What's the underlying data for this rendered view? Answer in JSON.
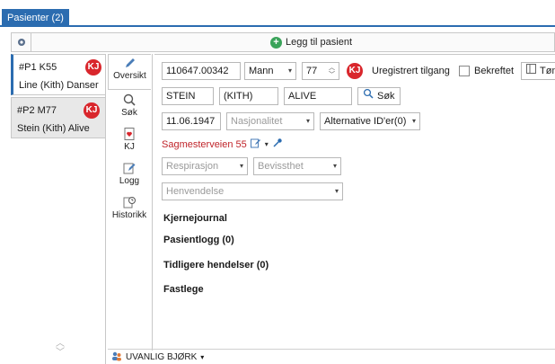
{
  "tab": {
    "label": "Pasienter (2)"
  },
  "toolbar": {
    "add_patient": "Legg til pasient",
    "settings_icon": "gear-icon"
  },
  "patients": [
    {
      "id": "#P1 K55",
      "name": "Line (Kith) Danser",
      "badge": "KJ"
    },
    {
      "id": "#P2 M77",
      "name": "Stein (Kith) Alive",
      "badge": "KJ"
    }
  ],
  "nav": [
    {
      "label": "Oversikt",
      "icon": "pencil-icon"
    },
    {
      "label": "Søk",
      "icon": "search-icon"
    },
    {
      "label": "KJ",
      "icon": "heart-document-icon"
    },
    {
      "label": "Logg",
      "icon": "edit-log-icon"
    },
    {
      "label": "Historikk",
      "icon": "history-icon"
    }
  ],
  "form": {
    "ssn": "110647.00342",
    "gender": "Mann",
    "age": "77",
    "badge": "KJ",
    "access": "Uregistrert tilgang",
    "confirmed": "Bekreftet",
    "clear": "Tøm",
    "first_name": "STEIN",
    "middle_name": "(KITH)",
    "last_name": "ALIVE",
    "search": "Søk",
    "birth_date": "11.06.1947",
    "nationality_placeholder": "Nasjonalitet",
    "alt_ids": "Alternative ID'er(0)",
    "address": "Sagmesterveien 55",
    "respiration_placeholder": "Respirasjon",
    "consciousness_placeholder": "Bevissthet",
    "inquiry_placeholder": "Henvendelse"
  },
  "sections": {
    "kjernejournal": "Kjernejournal",
    "pasientlogg": "Pasientlogg (0)",
    "hendelser": "Tidligere hendelser (0)",
    "fastlege": "Fastlege"
  },
  "status": {
    "user": "UVANLIG BJØRK"
  },
  "colors": {
    "accent": "#2b6cb0",
    "kj_red": "#d9262c",
    "address_red": "#c0242a",
    "add_green": "#3aa35a"
  }
}
